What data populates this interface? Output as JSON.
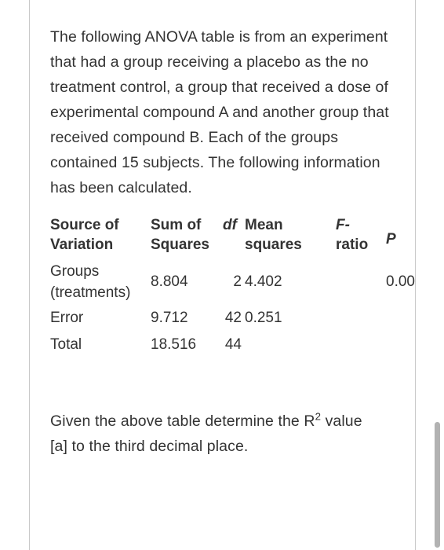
{
  "document": {
    "intro_paragraph": "The following ANOVA table is from an experiment that had a group receiving a placebo as the no treatment control, a group that received a dose of experimental compound A and another group that received compound B. Each of the groups contained 15 subjects. The following information has been calculated.",
    "question_prefix": "Given the above table determine the R",
    "question_superscript": "2",
    "question_suffix": " value [a] to the third decimal place."
  },
  "anova_table": {
    "headers": {
      "source_line1": "Source of",
      "source_line2": "Variation",
      "sum_squares_line1": "Sum of",
      "sum_squares_line2": "Squares",
      "df": "df",
      "mean_squares_line1": "Mean",
      "mean_squares_line2": "squares",
      "f_ratio_line1": "F-",
      "f_ratio_line2": "ratio",
      "p": "P"
    },
    "rows": [
      {
        "source_line1": "Groups",
        "source_line2": "(treatments)",
        "sum_of_squares": "8.804",
        "df": "2",
        "mean_squares": "4.402",
        "f_ratio": "",
        "p": "0.00"
      },
      {
        "source_line1": "Error",
        "source_line2": "",
        "sum_of_squares": "9.712",
        "df": "42",
        "mean_squares": "0.251",
        "f_ratio": "",
        "p": ""
      },
      {
        "source_line1": "Total",
        "source_line2": "",
        "sum_of_squares": "18.516",
        "df": "44",
        "mean_squares": "",
        "f_ratio": "",
        "p": ""
      }
    ]
  },
  "colors": {
    "text": "#333333",
    "divider": "#c9c9c9",
    "scrollbar_thumb": "#b2b2b2",
    "background": "#ffffff"
  }
}
